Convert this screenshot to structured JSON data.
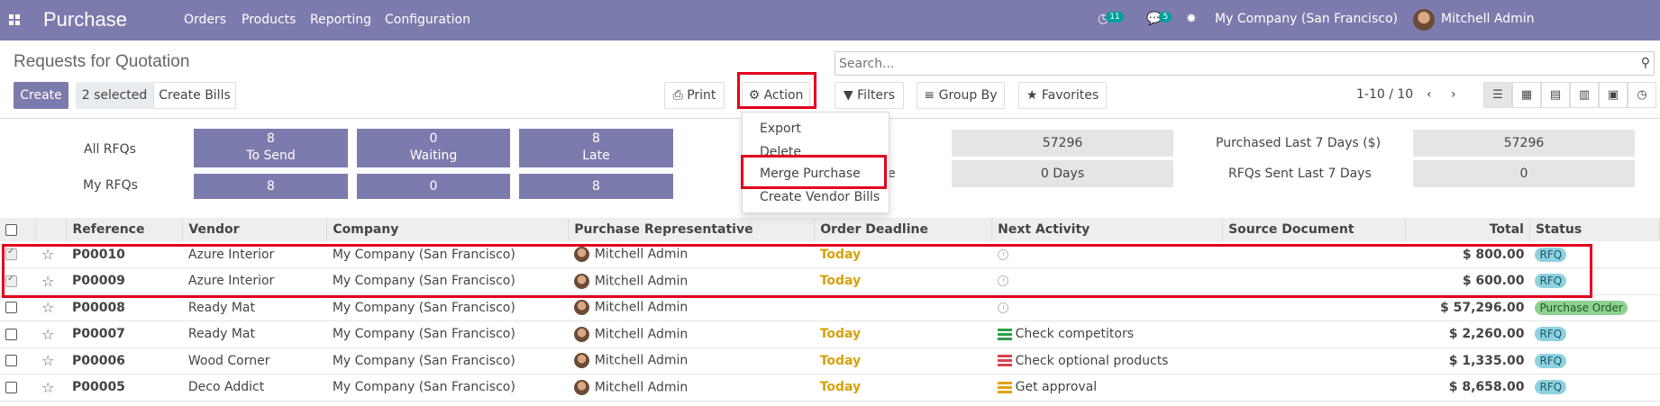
{
  "navbar": {
    "app_title": "Purchase",
    "menu": [
      "Orders",
      "Products",
      "Reporting",
      "Configuration"
    ],
    "activity_count": "11",
    "message_count": "5",
    "company": "My Company (San Francisco)",
    "user": "Mitchell Admin"
  },
  "control_panel": {
    "title": "Requests for Quotation",
    "search_placeholder": "Search...",
    "create_label": "Create",
    "selected_label": "2 selected",
    "create_bills_label": "Create Bills",
    "print_label": "Print",
    "action_label": "Action",
    "filters_label": "Filters",
    "groupby_label": "Group By",
    "favorites_label": "Favorites",
    "pager": "1-10 / 10"
  },
  "action_menu": [
    "Export",
    "Delete",
    "Merge Purchase",
    "Create Vendor Bills"
  ],
  "dashboard": {
    "all_rfqs_label": "All RFQs",
    "my_rfqs_label": "My RFQs",
    "to_send": {
      "count": "8",
      "label": "To Send",
      "mine": "8"
    },
    "waiting": {
      "count": "0",
      "label": "Waiting",
      "mine": "0"
    },
    "late": {
      "count": "8",
      "label": "Late",
      "mine": "8"
    },
    "avg_order_value": "57296",
    "lead_time_partial_label": "e",
    "lead_time": "0  Days",
    "purchased_7_days_label": "Purchased Last 7 Days ($)",
    "purchased_7_days": "57296",
    "rfqs_sent_label": "RFQs Sent Last 7 Days",
    "rfqs_sent": "0"
  },
  "table": {
    "headers": [
      "Reference",
      "Vendor",
      "Company",
      "Purchase Representative",
      "Order Deadline",
      "Next Activity",
      "Source Document",
      "Total",
      "Status"
    ],
    "rows": [
      {
        "ref": "P00010",
        "vendor": "Azure Interior",
        "company": "My Company (San Francisco)",
        "rep": "Mitchell Admin",
        "deadline": "Today",
        "activity": "",
        "source": "",
        "total": "$ 800.00",
        "status": "RFQ"
      },
      {
        "ref": "P00009",
        "vendor": "Azure Interior",
        "company": "My Company (San Francisco)",
        "rep": "Mitchell Admin",
        "deadline": "Today",
        "activity": "",
        "source": "",
        "total": "$ 600.00",
        "status": "RFQ"
      },
      {
        "ref": "P00008",
        "vendor": "Ready Mat",
        "company": "My Company (San Francisco)",
        "rep": "Mitchell Admin",
        "deadline": "",
        "activity": "",
        "source": "",
        "total": "$ 57,296.00",
        "status": "Purchase Order"
      },
      {
        "ref": "P00007",
        "vendor": "Ready Mat",
        "company": "My Company (San Francisco)",
        "rep": "Mitchell Admin",
        "deadline": "Today",
        "activity": "Check competitors",
        "source": "",
        "total": "$ 2,260.00",
        "status": "RFQ"
      },
      {
        "ref": "P00006",
        "vendor": "Wood Corner",
        "company": "My Company (San Francisco)",
        "rep": "Mitchell Admin",
        "deadline": "Today",
        "activity": "Check optional products",
        "source": "",
        "total": "$ 1,335.00",
        "status": "RFQ"
      },
      {
        "ref": "P00005",
        "vendor": "Deco Addict",
        "company": "My Company (San Francisco)",
        "rep": "Mitchell Admin",
        "deadline": "Today",
        "activity": "Get approval",
        "source": "",
        "total": "$ 8,658.00",
        "status": "RFQ"
      }
    ]
  },
  "colors": {
    "brand": "#7c7bad",
    "highlight": "#e3001b",
    "today": "#d4a20a",
    "rfq_badge": "#8ed2e0",
    "po_badge": "#8fd18f"
  }
}
